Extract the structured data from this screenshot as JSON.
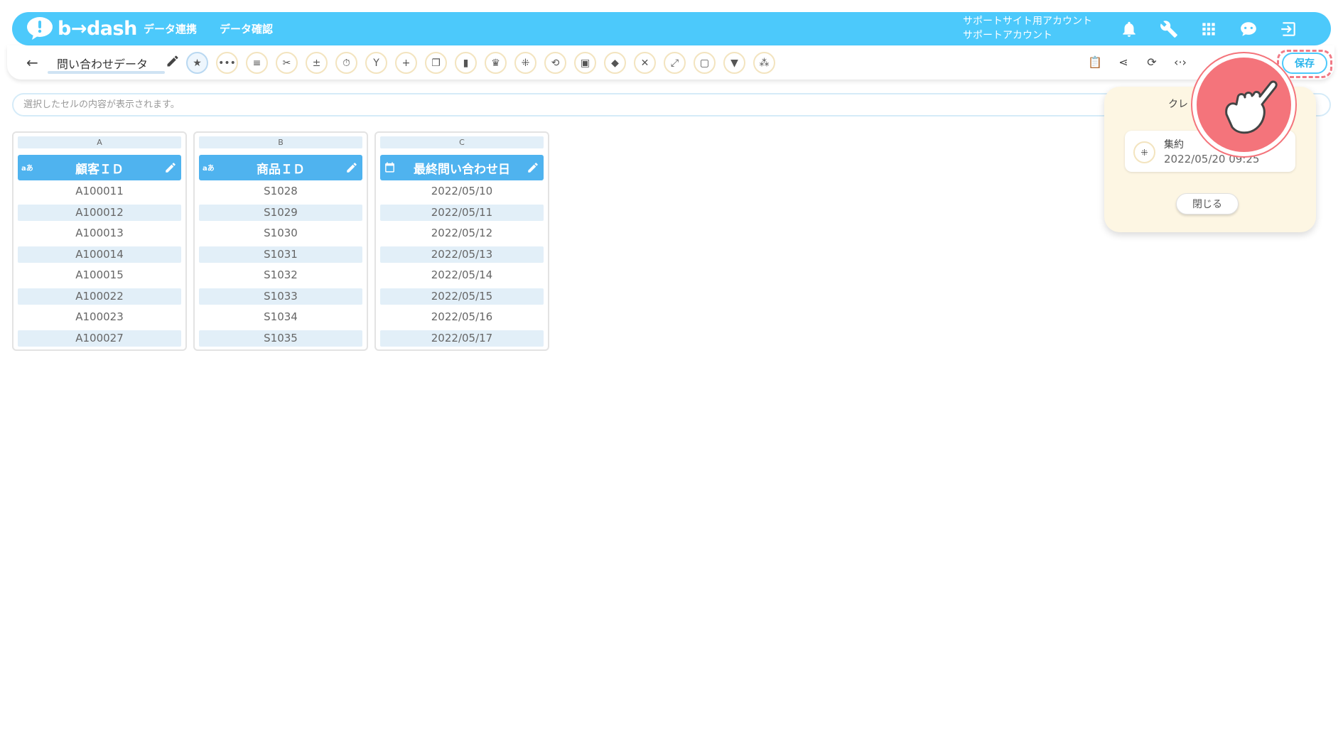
{
  "header": {
    "logo_text": "b→dash",
    "nav": [
      "データ連携",
      "データ確認"
    ],
    "account_line1": "サポートサイト用アカウント",
    "account_line2": "サポートアカウント",
    "icons": [
      "bell-icon",
      "wrench-icon",
      "apps-grid-icon",
      "chat-bot-icon",
      "logout-icon"
    ]
  },
  "toolbar": {
    "back_icon": "arrow-left-icon",
    "doc_title": "問い合わせデータ",
    "save_label": "保存",
    "tools": [
      "star-icon",
      "more-icon",
      "lines-icon",
      "scissors-icon",
      "calc-icon",
      "timer-icon",
      "branch-icon",
      "plus-icon",
      "copy-icon",
      "trash-icon",
      "crown-icon",
      "aggregate-icon",
      "loop-icon",
      "lock-icon",
      "box-icon",
      "cancel-icon",
      "transform-icon",
      "frame-icon",
      "filter-icon",
      "grid-icon"
    ],
    "right_icons": [
      "clipboard-icon",
      "share-icon",
      "refresh-icon",
      "code-icon"
    ]
  },
  "formula": {
    "placeholder": "選択したセルの内容が表示されます。"
  },
  "table": {
    "columns": [
      {
        "letter": "A",
        "header": "顧客ＩＤ",
        "type_icon": "aあ",
        "cells": [
          "A100011",
          "A100012",
          "A100013",
          "A100014",
          "A100015",
          "A100022",
          "A100023",
          "A100027"
        ]
      },
      {
        "letter": "B",
        "header": "商品ＩＤ",
        "type_icon": "aあ",
        "cells": [
          "S1028",
          "S1029",
          "S1030",
          "S1031",
          "S1032",
          "S1033",
          "S1034",
          "S1035"
        ]
      },
      {
        "letter": "C",
        "header": "最終問い合わせ日",
        "type_icon": "calendar",
        "cells": [
          "2022/05/10",
          "2022/05/11",
          "2022/05/12",
          "2022/05/13",
          "2022/05/14",
          "2022/05/15",
          "2022/05/16",
          "2022/05/17"
        ]
      }
    ]
  },
  "popup": {
    "title": "クレ",
    "item_title": "集約",
    "item_date": "2022/05/20 09:25",
    "close_label": "閉じる"
  },
  "colors": {
    "brand": "#4cc9fb",
    "header_col": "#4fb3ef",
    "row_alt": "#e2eff8",
    "highlight": "#f4747b"
  }
}
